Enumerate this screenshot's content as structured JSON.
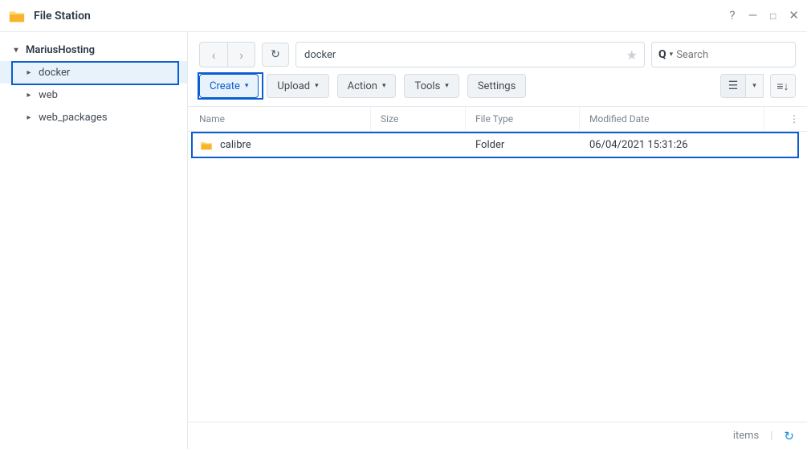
{
  "app": {
    "title": "File Station"
  },
  "sidebar": {
    "root": "MariusHosting",
    "items": [
      "docker",
      "web",
      "web_packages"
    ],
    "selected_index": 0
  },
  "path": {
    "value": "docker"
  },
  "search": {
    "placeholder": "Search"
  },
  "toolbar": {
    "create": "Create",
    "upload": "Upload",
    "action": "Action",
    "tools": "Tools",
    "settings": "Settings"
  },
  "table": {
    "headers": {
      "name": "Name",
      "size": "Size",
      "type": "File Type",
      "modified": "Modified Date"
    },
    "rows": [
      {
        "name": "calibre",
        "size": "",
        "type": "Folder",
        "modified": "06/04/2021 15:31:26"
      }
    ]
  },
  "status": {
    "items_label": "items"
  }
}
